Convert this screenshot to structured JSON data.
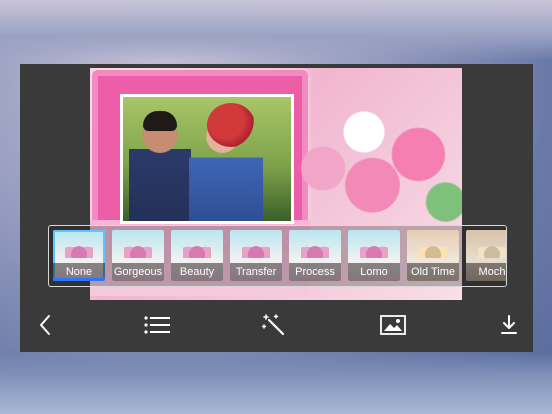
{
  "filters": {
    "items": [
      {
        "label": "None",
        "selected": true
      },
      {
        "label": "Gorgeous",
        "selected": false
      },
      {
        "label": "Beauty",
        "selected": false
      },
      {
        "label": "Transfer",
        "selected": false
      },
      {
        "label": "Process",
        "selected": false
      },
      {
        "label": "Lomo",
        "selected": false
      },
      {
        "label": "Old Time",
        "selected": false
      },
      {
        "label": "Moch",
        "selected": false
      }
    ],
    "selected_color": "#2d77ff"
  },
  "toolbar": {
    "icons": [
      "back-icon",
      "list-icon",
      "magic-wand-icon",
      "image-icon",
      "download-icon"
    ],
    "icon_color": "#ffffff"
  }
}
